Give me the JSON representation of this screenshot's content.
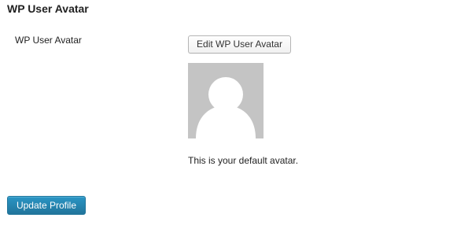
{
  "section": {
    "title": "WP User Avatar"
  },
  "field": {
    "label": "WP User Avatar",
    "edit_button_label": "Edit WP User Avatar",
    "avatar": {
      "icon": "default-avatar-silhouette",
      "background": "#c4c4c4",
      "foreground": "#ffffff"
    },
    "caption": "This is your default avatar."
  },
  "footer": {
    "update_button_label": "Update Profile",
    "update_button_color": "#21759b"
  }
}
